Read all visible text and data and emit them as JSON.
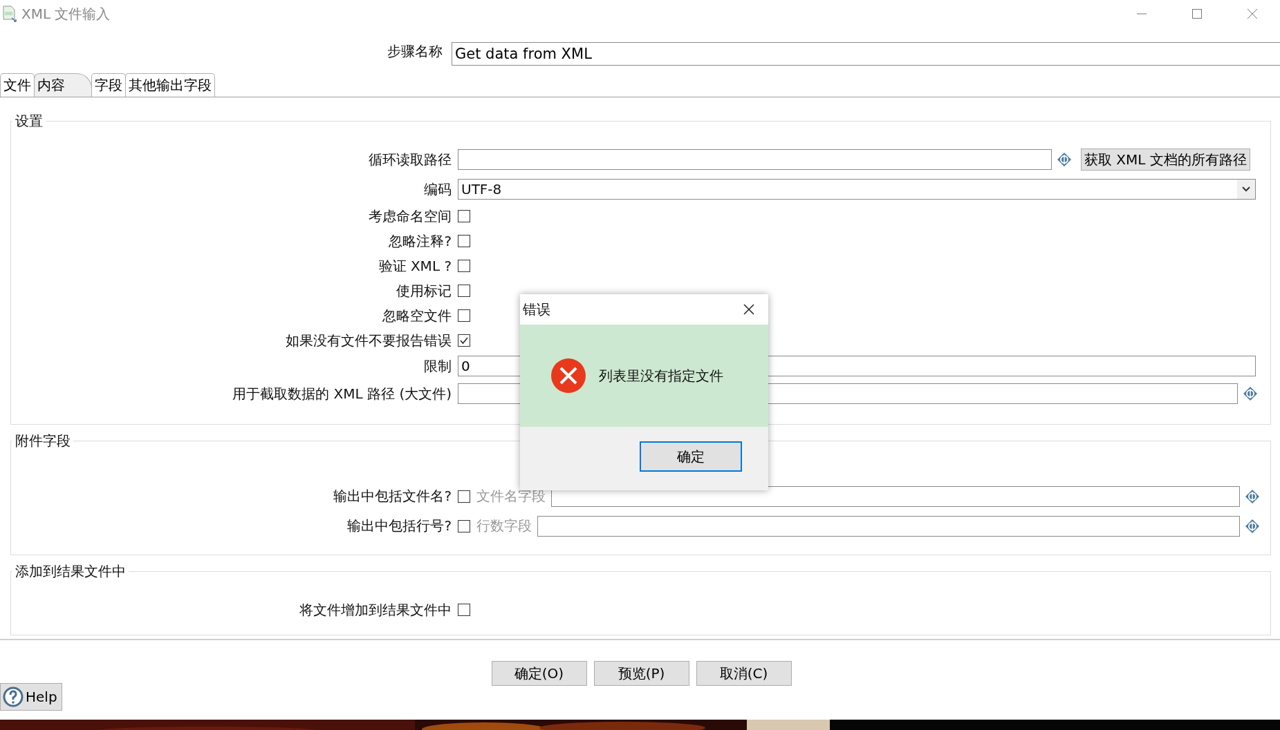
{
  "window": {
    "title": "XML 文件输入"
  },
  "step_name": {
    "label": "步骤名称",
    "value": "Get data from XML"
  },
  "tabs": [
    {
      "label": "文件",
      "selected": false
    },
    {
      "label": "内容",
      "selected": true
    },
    {
      "label": "字段",
      "selected": false
    },
    {
      "label": "其他输出字段",
      "selected": false
    }
  ],
  "groups": [
    {
      "title": "设置",
      "rows": [
        {
          "kind": "field_button",
          "label": "循环读取路径",
          "button": "获取 XML 文档的所有路径"
        },
        {
          "kind": "select",
          "label": "编码",
          "value": "UTF-8"
        },
        {
          "kind": "checkbox",
          "label": "考虑命名空间",
          "checked": false
        },
        {
          "kind": "checkbox",
          "label": "忽略注释?",
          "checked": false
        },
        {
          "kind": "checkbox",
          "label": "验证 XML ?",
          "checked": false
        },
        {
          "kind": "checkbox",
          "label": "使用标记",
          "checked": false
        },
        {
          "kind": "checkbox",
          "label": "忽略空文件",
          "checked": false
        },
        {
          "kind": "checkbox",
          "label": "如果没有文件不要报告错误",
          "checked": true
        },
        {
          "kind": "text",
          "label": "限制",
          "value": "0"
        },
        {
          "kind": "field_var",
          "label": "用于截取数据的 XML 路径 (大文件)"
        }
      ]
    },
    {
      "title": "附件字段",
      "rows": [
        {
          "kind": "checkbox_field",
          "label": "输出中包括文件名?",
          "checked": false,
          "field_label": "文件名字段",
          "field_disabled": true
        },
        {
          "kind": "checkbox_field",
          "label": "输出中包括行号?",
          "checked": false,
          "field_label": "行数字段",
          "field_disabled": true
        }
      ]
    },
    {
      "title": "添加到结果文件中",
      "rows": [
        {
          "kind": "checkbox",
          "label": "将文件增加到结果文件中",
          "checked": false
        }
      ]
    }
  ],
  "buttons": [
    "确定(O)",
    "预览(P)",
    "取消(C)"
  ],
  "help": {
    "label": "Help"
  },
  "dialog": {
    "title": "错误",
    "message": "列表里没有指定文件",
    "button": "确定"
  }
}
